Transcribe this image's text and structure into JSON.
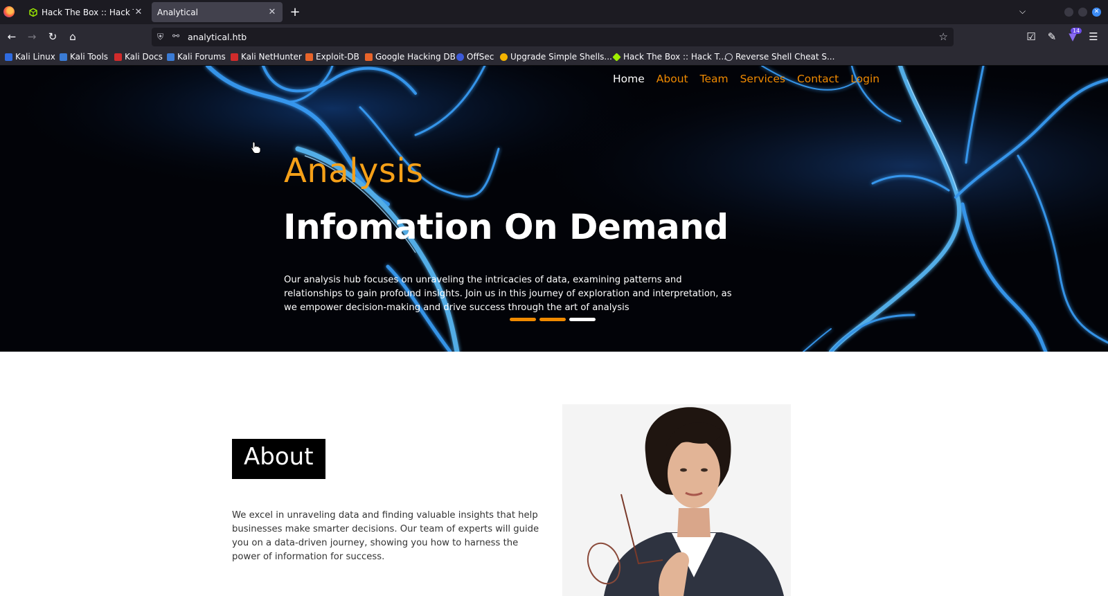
{
  "browser": {
    "tabs": [
      {
        "title": "Hack The Box :: Hack The Box",
        "close": "✕"
      },
      {
        "title": "Analytical",
        "close": "✕"
      }
    ],
    "new_tab": "+",
    "url": "analytical.htb",
    "extension_badge": "14",
    "bookmarks": [
      {
        "label": "Kali Linux",
        "color": "#2f6be0"
      },
      {
        "label": "Kali Tools",
        "color": "#3a7bd5"
      },
      {
        "label": "Kali Docs",
        "color": "#d12b2b"
      },
      {
        "label": "Kali Forums",
        "color": "#3a7bd5"
      },
      {
        "label": "Kali NetHunter",
        "color": "#d12b2b"
      },
      {
        "label": "Exploit-DB",
        "color": "#e8642a"
      },
      {
        "label": "Google Hacking DB",
        "color": "#e8642a"
      },
      {
        "label": "OffSec",
        "color": "#3d5ad8"
      },
      {
        "label": "Upgrade Simple Shells...",
        "color": "#f5b400"
      },
      {
        "label": "Hack The Box :: Hack T...",
        "color": "#9fef00"
      },
      {
        "label": "Reverse Shell Cheat S...",
        "color": "#cfcfd8"
      }
    ]
  },
  "site": {
    "nav": [
      {
        "label": "Home",
        "active": true
      },
      {
        "label": "About",
        "active": false
      },
      {
        "label": "Team",
        "active": false
      },
      {
        "label": "Services",
        "active": false
      },
      {
        "label": "Contact",
        "active": false
      },
      {
        "label": "Login",
        "active": false
      }
    ],
    "hero": {
      "subtitle": "Analysis",
      "title": "Infomation On Demand",
      "text": "Our analysis hub focuses on unraveling the intricacies of data, examining patterns and relationships to gain profound insights. Join us in this journey of exploration and interpretation, as we empower decision-making and drive success through the art of analysis",
      "slides": 3,
      "active_slide": 3
    },
    "about": {
      "title": "About",
      "text": "We excel in unraveling data and finding valuable insights that help businesses make smarter decisions. Our team of experts will guide you on a data-driven journey, showing you how to harness the power of information for success."
    }
  },
  "colors": {
    "accent": "#f08a00",
    "hero_subtitle": "#f5a018",
    "hero_bg": "#020308"
  }
}
